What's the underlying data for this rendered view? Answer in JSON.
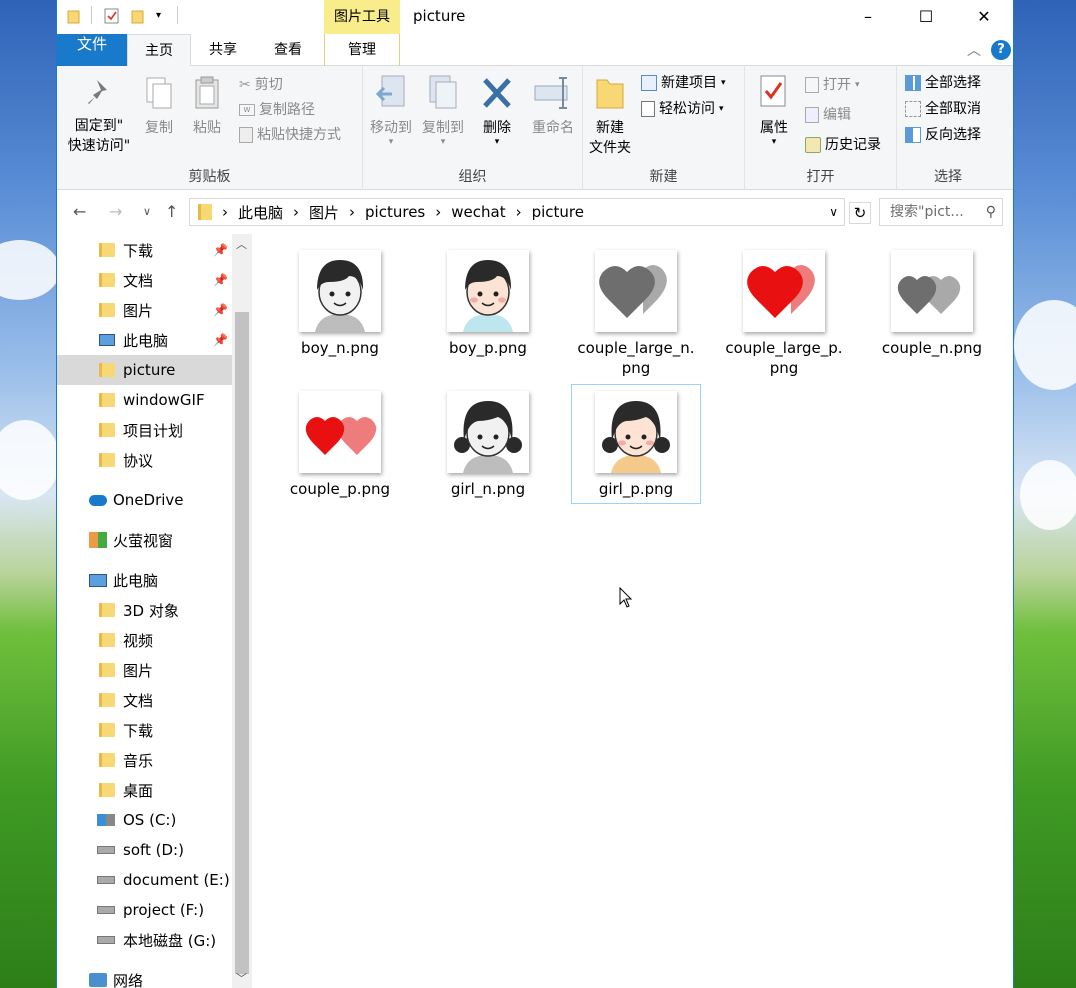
{
  "window": {
    "title": "picture"
  },
  "titlebar": {
    "context_tab": "图片工具",
    "min": "–",
    "max": "☐",
    "close": "✕"
  },
  "tabs": {
    "file": "文件",
    "home": "主页",
    "share": "共享",
    "view": "查看",
    "manage": "管理"
  },
  "ribbon": {
    "clipboard": {
      "label": "剪贴板",
      "pin_line1": "固定到\"",
      "pin_line2": "快速访问\"",
      "copy": "复制",
      "paste": "粘贴",
      "cut": "剪切",
      "copy_path": "复制路径",
      "paste_shortcut": "粘贴快捷方式"
    },
    "organize": {
      "label": "组织",
      "move_to": "移动到",
      "copy_to": "复制到",
      "delete": "删除",
      "rename": "重命名"
    },
    "new": {
      "label": "新建",
      "new_folder_line1": "新建",
      "new_folder_line2": "文件夹",
      "new_item": "新建项目",
      "easy_access": "轻松访问"
    },
    "open": {
      "label": "打开",
      "properties": "属性",
      "open": "打开",
      "edit": "编辑",
      "history": "历史记录"
    },
    "select": {
      "label": "选择",
      "select_all": "全部选择",
      "select_none": "全部取消",
      "invert": "反向选择"
    }
  },
  "address": {
    "crumbs": [
      "此电脑",
      "图片",
      "pictures",
      "wechat",
      "picture"
    ],
    "search_placeholder": "搜索\"pict..."
  },
  "tree": [
    {
      "label": "下载",
      "pinned": true
    },
    {
      "label": "文档",
      "pinned": true
    },
    {
      "label": "图片",
      "pinned": true
    },
    {
      "label": "此电脑",
      "pinned": true
    },
    {
      "label": "picture",
      "selected": true
    },
    {
      "label": "windowGIF"
    },
    {
      "label": "项目计划"
    },
    {
      "label": "协议"
    },
    {
      "label": "OneDrive"
    },
    {
      "label": "火萤视窗"
    },
    {
      "label": "此电脑"
    },
    {
      "label": "3D 对象"
    },
    {
      "label": "视频"
    },
    {
      "label": "图片"
    },
    {
      "label": "文档"
    },
    {
      "label": "下载"
    },
    {
      "label": "音乐"
    },
    {
      "label": "桌面"
    },
    {
      "label": "OS (C:)"
    },
    {
      "label": "soft (D:)"
    },
    {
      "label": "document (E:)"
    },
    {
      "label": "project (F:)"
    },
    {
      "label": "本地磁盘 (G:)"
    },
    {
      "label": "网络"
    }
  ],
  "files": [
    {
      "name_l1": "boy_n.png",
      "name_l2": ""
    },
    {
      "name_l1": "boy_p.png",
      "name_l2": ""
    },
    {
      "name_l1": "couple_large_n.",
      "name_l2": "png"
    },
    {
      "name_l1": "couple_large_p.",
      "name_l2": "png"
    },
    {
      "name_l1": "couple_n.png",
      "name_l2": ""
    },
    {
      "name_l1": "couple_p.png",
      "name_l2": ""
    },
    {
      "name_l1": "girl_n.png",
      "name_l2": ""
    },
    {
      "name_l1": "girl_p.png",
      "name_l2": ""
    }
  ],
  "colors": {
    "accent": "#1979ca",
    "context_tab": "#f8ec8b",
    "heart_red": "#e81010",
    "heart_pink": "#ef7c7c",
    "heart_gray": "#6e6e6e"
  }
}
